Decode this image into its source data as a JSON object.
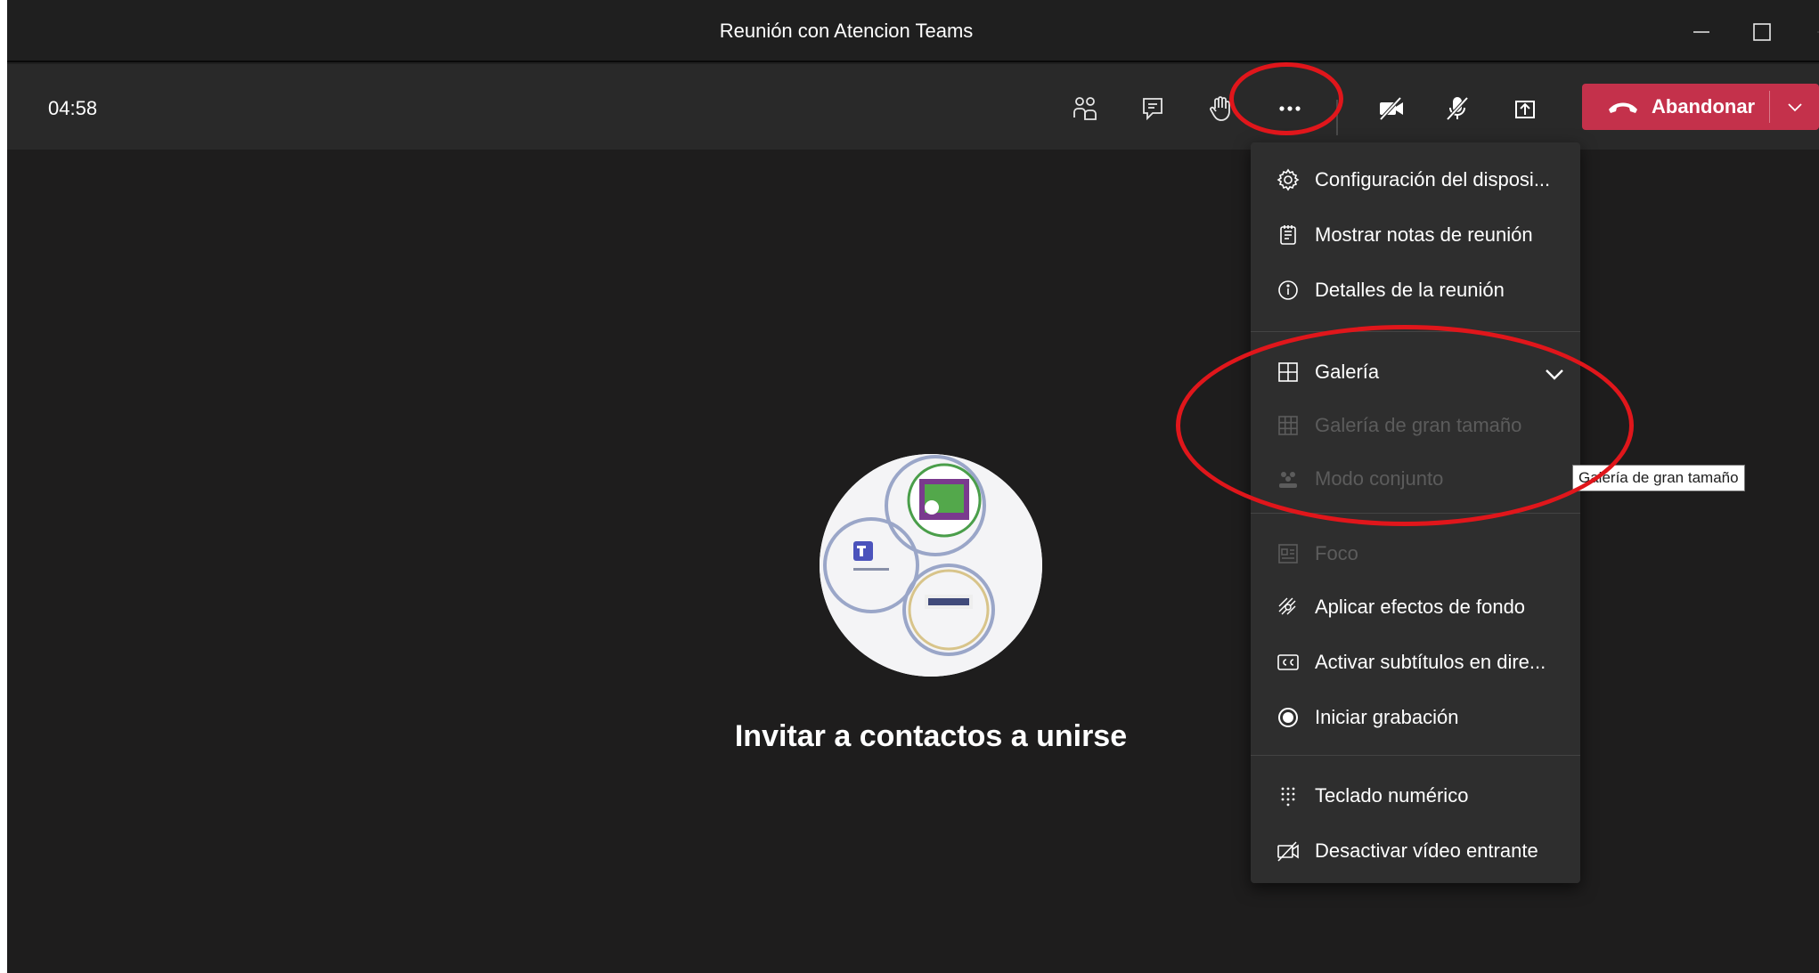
{
  "window": {
    "title": "Reunión con Atencion Teams"
  },
  "toolbar": {
    "timer": "04:58",
    "buttons": [
      {
        "name": "participants",
        "icon": "people-icon"
      },
      {
        "name": "chat",
        "icon": "chat-icon"
      },
      {
        "name": "raise-hand",
        "icon": "hand-icon"
      },
      {
        "name": "more-actions",
        "icon": "more-dots-icon"
      },
      {
        "name": "camera-off",
        "icon": "camera-off-icon"
      },
      {
        "name": "mic-off",
        "icon": "mic-off-icon"
      },
      {
        "name": "share",
        "icon": "share-tray-icon"
      }
    ],
    "leave_label": "Abandonar"
  },
  "stage": {
    "invite_text": "Invitar a contactos a unirse"
  },
  "menu": {
    "items": [
      {
        "label": "Configuración del disposi...",
        "icon": "gear-icon",
        "enabled": true
      },
      {
        "label": "Mostrar notas de reunión",
        "icon": "notes-icon",
        "enabled": true
      },
      {
        "label": "Detalles de la reunión",
        "icon": "info-icon",
        "enabled": true
      },
      {
        "label": "Galería",
        "icon": "grid-icon",
        "enabled": true,
        "checked": true
      },
      {
        "label": "Galería de gran tamaño",
        "icon": "large-grid-icon",
        "enabled": false
      },
      {
        "label": "Modo conjunto",
        "icon": "together-icon",
        "enabled": false
      },
      {
        "label": "Foco",
        "icon": "focus-icon",
        "enabled": false
      },
      {
        "label": "Aplicar efectos de fondo",
        "icon": "background-effects-icon",
        "enabled": true
      },
      {
        "label": "Activar subtítulos en dire...",
        "icon": "cc-icon",
        "enabled": true
      },
      {
        "label": "Iniciar grabación",
        "icon": "record-icon",
        "enabled": true
      },
      {
        "label": "Teclado numérico",
        "icon": "dialpad-icon",
        "enabled": true
      },
      {
        "label": "Desactivar vídeo entrante",
        "icon": "video-off-icon",
        "enabled": true
      }
    ]
  },
  "tooltip": {
    "text": "Galería de gran tamaño"
  },
  "colors": {
    "accent_leave": "#c4314b",
    "annotation_ring": "#e0161b",
    "background": "#1e1d1d"
  }
}
